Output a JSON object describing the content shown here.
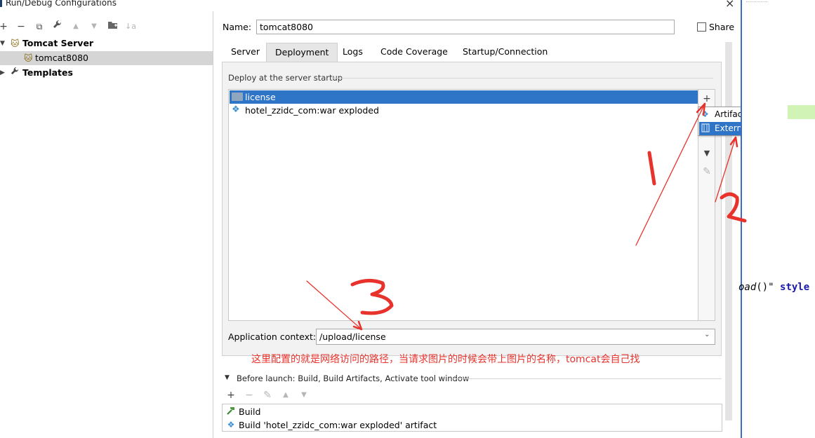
{
  "window": {
    "title": "Run/Debug Configurations",
    "close_glyph": "×"
  },
  "left_toolbar": {
    "add": "+",
    "remove": "−",
    "copy": "⧉",
    "edit_defaults": "🔧",
    "move_up": "▲",
    "move_down": "▼",
    "new_folder": "📁",
    "sort": "↓a"
  },
  "tree": {
    "items": [
      {
        "label": "Tomcat Server",
        "icon": "tomcat-icon",
        "expanded": true
      },
      {
        "label": "tomcat8080",
        "icon": "tomcat-icon",
        "selected": true
      },
      {
        "label": "Templates",
        "icon": "wrench-icon",
        "expanded": false
      }
    ]
  },
  "name_field": {
    "label": "Name:",
    "value": "tomcat8080"
  },
  "share": {
    "label": "Share",
    "checked": false
  },
  "tabs": [
    {
      "label": "Server"
    },
    {
      "label": "Deployment",
      "active": true
    },
    {
      "label": "Logs"
    },
    {
      "label": "Code Coverage"
    },
    {
      "label": "Startup/Connection"
    }
  ],
  "deploy": {
    "header": "Deploy at the server startup",
    "items": [
      {
        "label": "license",
        "icon": "folder-icon",
        "selected": true
      },
      {
        "label": "hotel_zzidc_com:war exploded",
        "icon": "artifact-icon"
      }
    ],
    "toolbar": {
      "add": "+",
      "move_down": "▼",
      "edit": "✎"
    }
  },
  "add_popup": {
    "items": [
      {
        "label": "Artifact...",
        "icon": "artifact-icon"
      },
      {
        "label": "External Source...",
        "icon": "external-source-icon",
        "selected": true
      }
    ]
  },
  "application_context": {
    "label": "Application context:",
    "value": "/upload/license"
  },
  "annotation": {
    "note": "这里配置的就是网络访问的路径，当请求图片的时候会带上图片的名称，tomcat会自己找",
    "step1": "1",
    "step2": "2",
    "step3": "3",
    "color": "#e8322c"
  },
  "before_launch": {
    "header": "Before launch: Build, Build Artifacts, Activate tool window",
    "toolbar": {
      "add": "+",
      "remove": "−",
      "edit": "✎",
      "up": "▲",
      "down": "▼"
    },
    "items": [
      {
        "label": "Build",
        "icon": "build-icon"
      },
      {
        "label": "Build 'hotel_zzidc_com:war exploded' artifact",
        "icon": "artifact-icon"
      }
    ]
  },
  "editor_background": {
    "code_italic": "oad",
    "code_rest": "()\" ",
    "code_keyword": "style"
  },
  "colors": {
    "selection": "#2f75c7",
    "annotation_red": "#e8322c",
    "editor_green": "#d1f3b5"
  }
}
